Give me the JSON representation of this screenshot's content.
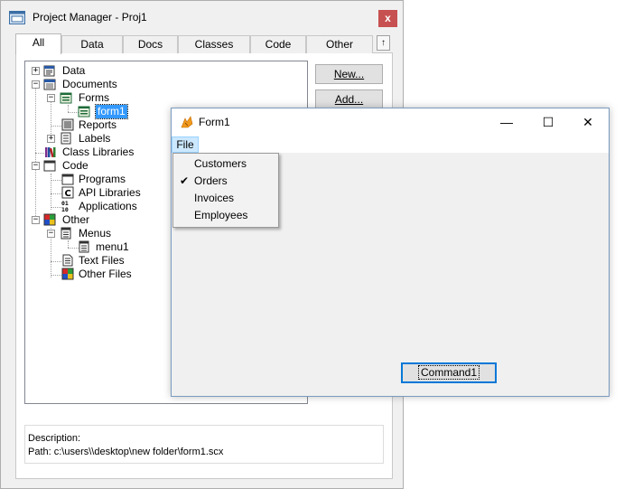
{
  "project_manager": {
    "title": "Project Manager - Proj1",
    "close_label": "x",
    "tabs": [
      {
        "label": "All",
        "active": true
      },
      {
        "label": "Data",
        "active": false
      },
      {
        "label": "Docs",
        "active": false
      },
      {
        "label": "Classes",
        "active": false
      },
      {
        "label": "Code",
        "active": false
      },
      {
        "label": "Other",
        "active": false
      }
    ],
    "tab_scroll_label": "↑",
    "tree": [
      {
        "label": "Data",
        "icon": "data-icon",
        "expander": "+"
      },
      {
        "label": "Documents",
        "icon": "documents-icon",
        "expander": "−"
      },
      {
        "label": "Forms",
        "icon": "forms-icon",
        "expander": "−"
      },
      {
        "label": "form1",
        "icon": "form-icon",
        "selected": true
      },
      {
        "label": "Reports",
        "icon": "reports-icon"
      },
      {
        "label": "Labels",
        "icon": "labels-icon",
        "expander": "+"
      },
      {
        "label": "Class Libraries",
        "icon": "class-libraries-icon"
      },
      {
        "label": "Code",
        "icon": "code-icon",
        "expander": "−"
      },
      {
        "label": "Programs",
        "icon": "programs-icon"
      },
      {
        "label": "API Libraries",
        "icon": "api-libraries-icon"
      },
      {
        "label": "Applications",
        "icon": "applications-icon"
      },
      {
        "label": "Other",
        "icon": "other-icon",
        "expander": "−"
      },
      {
        "label": "Menus",
        "icon": "menus-icon",
        "expander": "−"
      },
      {
        "label": "menu1",
        "icon": "menu-icon"
      },
      {
        "label": "Text Files",
        "icon": "text-files-icon"
      },
      {
        "label": "Other Files",
        "icon": "other-files-icon"
      }
    ],
    "buttons": {
      "new_label": "New...",
      "add_label": "Add..."
    },
    "description": {
      "label": "Description:",
      "path": "Path: c:\\users\\\\desktop\\new folder\\form1.scx"
    }
  },
  "form1": {
    "title": "Form1",
    "minimize_label": "—",
    "maximize_label": "☐",
    "close_label": "✕",
    "menu": {
      "file_label": "File",
      "items": [
        {
          "label": "Customers",
          "checked": false
        },
        {
          "label": "Orders",
          "checked": true
        },
        {
          "label": "Invoices",
          "checked": false
        },
        {
          "label": "Employees",
          "checked": false
        }
      ],
      "check_glyph": "✔"
    },
    "command_label": "Command1"
  },
  "colors": {
    "selection": "#3399ff",
    "menu_highlight": "#cce8ff",
    "focus_border": "#0078d7",
    "close_button": "#c75050"
  }
}
